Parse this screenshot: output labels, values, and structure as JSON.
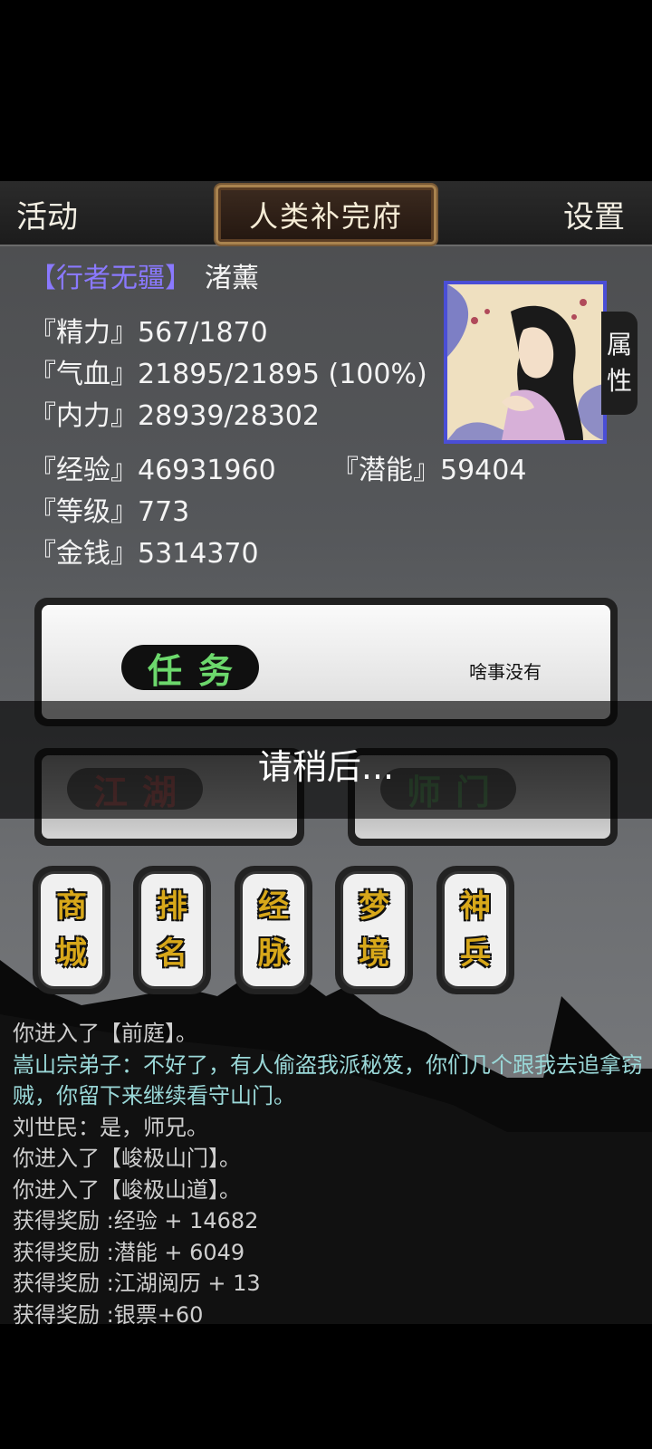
{
  "header": {
    "activity_label": "活动",
    "location": "人类补完府",
    "settings_label": "设置"
  },
  "character": {
    "title": "【行者无疆】",
    "name": "渚薰",
    "attr_tab": [
      "属",
      "性"
    ],
    "stats": {
      "stamina": "『精力』567/1870",
      "health": "『气血』21895/21895 (100%)",
      "inner_power": "『内力』28939/28302",
      "experience": "『经验』46931960",
      "potential": "『潜能』59404",
      "level": "『等级』773",
      "money": "『金钱』5314370"
    }
  },
  "task": {
    "label": "任务",
    "status": "啥事没有"
  },
  "sub_buttons": {
    "jianghu": "江湖",
    "shimen": "师门"
  },
  "loading": "请稍后...",
  "menu": [
    {
      "top": "商",
      "bottom": "城"
    },
    {
      "top": "排",
      "bottom": "名"
    },
    {
      "top": "经",
      "bottom": "脉"
    },
    {
      "top": "梦",
      "bottom": "境"
    },
    {
      "top": "神",
      "bottom": "兵"
    }
  ],
  "log": [
    "你进入了【前庭】。",
    "嵩山宗弟子：不好了，有人偷盗我派秘笈，你们几个跟我去追拿窃贼，你留下来继续看守山门。",
    "刘世民：是，师兄。",
    "你进入了【峻极山门】。",
    "你进入了【峻极山道】。",
    "获得奖励 :经验 + 14682",
    "获得奖励 :潜能 + 6049",
    "获得奖励 :江湖阅历 + 13",
    "获得奖励 :银票+60"
  ]
}
